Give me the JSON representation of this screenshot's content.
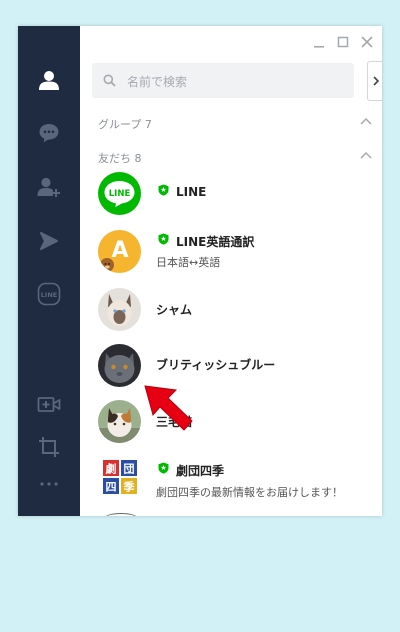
{
  "window": {
    "buttons": [
      "minimize",
      "maximize",
      "close"
    ]
  },
  "sidebar": {
    "items": [
      {
        "name": "friends",
        "icon": "person-icon",
        "active": true
      },
      {
        "name": "chats",
        "icon": "chat-bubble-icon"
      },
      {
        "name": "add-friend",
        "icon": "add-person-icon"
      },
      {
        "name": "timeline",
        "icon": "play-icon"
      },
      {
        "name": "line",
        "icon": "line-logo-icon",
        "label": "LINE"
      }
    ],
    "bottom": [
      {
        "name": "video-call",
        "icon": "video-plus-icon"
      },
      {
        "name": "crop",
        "icon": "crop-icon"
      },
      {
        "name": "more",
        "icon": "more-icon"
      }
    ]
  },
  "search": {
    "placeholder": "名前で検索"
  },
  "groups": {
    "label": "グループ 7"
  },
  "friends": {
    "label": "友だち 8",
    "items": [
      {
        "name": "LINE",
        "verified": true,
        "sub": ""
      },
      {
        "name": "LINE英語通訳",
        "verified": true,
        "sub": "日本語↔英語"
      },
      {
        "name": "シャム",
        "verified": false,
        "sub": ""
      },
      {
        "name": "ブリティッシュブルー",
        "verified": false,
        "sub": ""
      },
      {
        "name": "三毛猫",
        "verified": false,
        "sub": ""
      },
      {
        "name": "劇団四季",
        "verified": true,
        "sub": "劇団四季の最新情報をお届けします！"
      }
    ]
  },
  "avatar_text": {
    "line": "LINE",
    "translator": "A",
    "shiki": [
      "劇",
      "団",
      "四",
      "季"
    ]
  },
  "colors": {
    "sidebar": "#1f2b40",
    "line_green": "#00b900",
    "arrow_red": "#e60012",
    "translator_yellow": "#f5b52e",
    "background": "#d2f1f6"
  }
}
